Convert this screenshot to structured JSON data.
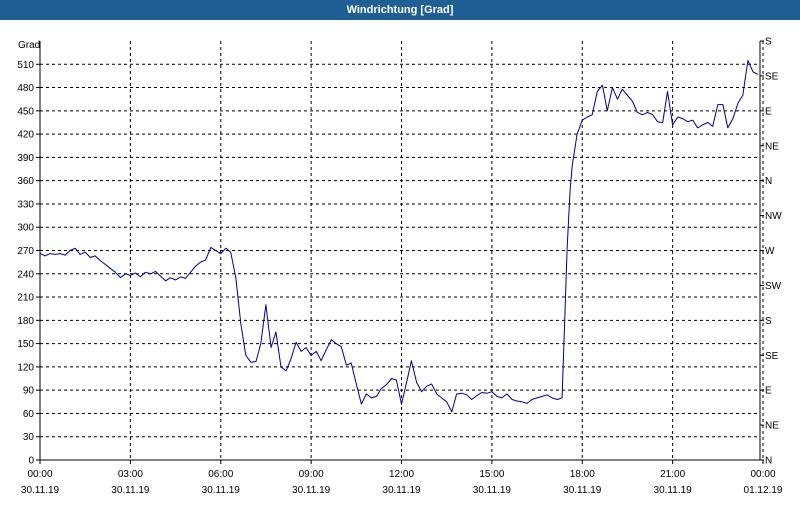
{
  "window": {
    "title": "Windrichtung [Grad]"
  },
  "chart_data": {
    "type": "line",
    "title": "Windrichtung [Grad]",
    "ylabel": "Grad",
    "xlabel": "",
    "ylim": [
      0,
      540
    ],
    "xlim_hours": [
      0,
      23.9
    ],
    "grid": true,
    "y_ticks": [
      0,
      30,
      60,
      90,
      120,
      150,
      180,
      210,
      240,
      270,
      300,
      330,
      360,
      390,
      420,
      450,
      480,
      510
    ],
    "x_ticks": [
      {
        "h": 0,
        "time": "00:00",
        "date": "30.11.19"
      },
      {
        "h": 3,
        "time": "03:00",
        "date": "30.11.19"
      },
      {
        "h": 6,
        "time": "06:00",
        "date": "30.11.19"
      },
      {
        "h": 9,
        "time": "09:00",
        "date": "30.11.19"
      },
      {
        "h": 12,
        "time": "12:00",
        "date": "30.11.19"
      },
      {
        "h": 15,
        "time": "15:00",
        "date": "30.11.19"
      },
      {
        "h": 18,
        "time": "18:00",
        "date": "30.11.19"
      },
      {
        "h": 21,
        "time": "21:00",
        "date": "30.11.19"
      },
      {
        "h": 24,
        "time": "00:00",
        "date": "01.12.19"
      }
    ],
    "right_axis": [
      {
        "value": 0,
        "label": "N"
      },
      {
        "value": 45,
        "label": "NE"
      },
      {
        "value": 90,
        "label": "E"
      },
      {
        "value": 135,
        "label": "SE"
      },
      {
        "value": 180,
        "label": "S"
      },
      {
        "value": 225,
        "label": "SW"
      },
      {
        "value": 270,
        "label": "W"
      },
      {
        "value": 315,
        "label": "NW"
      },
      {
        "value": 360,
        "label": "N"
      },
      {
        "value": 405,
        "label": "NE"
      },
      {
        "value": 450,
        "label": "E"
      },
      {
        "value": 495,
        "label": "SE"
      },
      {
        "value": 540,
        "label": "S"
      }
    ],
    "series": [
      {
        "color": "#00008b",
        "points": [
          [
            0.0,
            266
          ],
          [
            0.17,
            263
          ],
          [
            0.33,
            266
          ],
          [
            0.5,
            265
          ],
          [
            0.67,
            266
          ],
          [
            0.83,
            264
          ],
          [
            1.0,
            270
          ],
          [
            1.17,
            273
          ],
          [
            1.33,
            265
          ],
          [
            1.5,
            268
          ],
          [
            1.67,
            261
          ],
          [
            1.83,
            263
          ],
          [
            2.0,
            257
          ],
          [
            2.17,
            252
          ],
          [
            2.33,
            247
          ],
          [
            2.5,
            242
          ],
          [
            2.67,
            235
          ],
          [
            2.83,
            240
          ],
          [
            3.0,
            238
          ],
          [
            3.17,
            241
          ],
          [
            3.33,
            236
          ],
          [
            3.5,
            242
          ],
          [
            3.67,
            240
          ],
          [
            3.83,
            243
          ],
          [
            4.0,
            237
          ],
          [
            4.17,
            231
          ],
          [
            4.33,
            235
          ],
          [
            4.5,
            232
          ],
          [
            4.67,
            236
          ],
          [
            4.83,
            234
          ],
          [
            5.0,
            242
          ],
          [
            5.17,
            250
          ],
          [
            5.33,
            255
          ],
          [
            5.5,
            258
          ],
          [
            5.67,
            274
          ],
          [
            5.83,
            270
          ],
          [
            6.0,
            266
          ],
          [
            6.17,
            273
          ],
          [
            6.33,
            268
          ],
          [
            6.5,
            235
          ],
          [
            6.67,
            175
          ],
          [
            6.83,
            135
          ],
          [
            7.0,
            126
          ],
          [
            7.17,
            127
          ],
          [
            7.33,
            150
          ],
          [
            7.5,
            200
          ],
          [
            7.67,
            145
          ],
          [
            7.83,
            165
          ],
          [
            8.0,
            120
          ],
          [
            8.17,
            115
          ],
          [
            8.33,
            130
          ],
          [
            8.5,
            152
          ],
          [
            8.67,
            140
          ],
          [
            8.83,
            145
          ],
          [
            9.0,
            135
          ],
          [
            9.17,
            140
          ],
          [
            9.33,
            128
          ],
          [
            9.5,
            142
          ],
          [
            9.67,
            155
          ],
          [
            9.83,
            150
          ],
          [
            10.0,
            146
          ],
          [
            10.17,
            122
          ],
          [
            10.33,
            125
          ],
          [
            10.5,
            98
          ],
          [
            10.67,
            72
          ],
          [
            10.83,
            85
          ],
          [
            11.0,
            80
          ],
          [
            11.17,
            82
          ],
          [
            11.33,
            92
          ],
          [
            11.5,
            97
          ],
          [
            11.67,
            105
          ],
          [
            11.83,
            103
          ],
          [
            12.0,
            72
          ],
          [
            12.17,
            100
          ],
          [
            12.33,
            128
          ],
          [
            12.5,
            100
          ],
          [
            12.67,
            88
          ],
          [
            12.83,
            95
          ],
          [
            13.0,
            98
          ],
          [
            13.17,
            85
          ],
          [
            13.33,
            80
          ],
          [
            13.5,
            75
          ],
          [
            13.67,
            62
          ],
          [
            13.83,
            85
          ],
          [
            14.0,
            86
          ],
          [
            14.17,
            84
          ],
          [
            14.33,
            78
          ],
          [
            14.5,
            83
          ],
          [
            14.67,
            87
          ],
          [
            14.83,
            86
          ],
          [
            15.0,
            88
          ],
          [
            15.17,
            82
          ],
          [
            15.33,
            80
          ],
          [
            15.5,
            85
          ],
          [
            15.67,
            78
          ],
          [
            15.83,
            76
          ],
          [
            16.0,
            75
          ],
          [
            16.17,
            73
          ],
          [
            16.33,
            78
          ],
          [
            16.5,
            80
          ],
          [
            16.67,
            82
          ],
          [
            16.83,
            84
          ],
          [
            17.0,
            80
          ],
          [
            17.17,
            78
          ],
          [
            17.33,
            80
          ],
          [
            17.5,
            275
          ],
          [
            17.6,
            350
          ],
          [
            17.67,
            380
          ],
          [
            17.83,
            420
          ],
          [
            18.0,
            438
          ],
          [
            18.17,
            442
          ],
          [
            18.33,
            445
          ],
          [
            18.5,
            475
          ],
          [
            18.67,
            483
          ],
          [
            18.83,
            450
          ],
          [
            19.0,
            480
          ],
          [
            19.17,
            465
          ],
          [
            19.33,
            478
          ],
          [
            19.5,
            470
          ],
          [
            19.67,
            462
          ],
          [
            19.83,
            448
          ],
          [
            20.0,
            445
          ],
          [
            20.17,
            448
          ],
          [
            20.33,
            445
          ],
          [
            20.5,
            436
          ],
          [
            20.67,
            435
          ],
          [
            20.83,
            475
          ],
          [
            21.0,
            432
          ],
          [
            21.17,
            442
          ],
          [
            21.33,
            440
          ],
          [
            21.5,
            436
          ],
          [
            21.67,
            438
          ],
          [
            21.83,
            428
          ],
          [
            22.0,
            432
          ],
          [
            22.17,
            435
          ],
          [
            22.33,
            430
          ],
          [
            22.5,
            458
          ],
          [
            22.67,
            458
          ],
          [
            22.83,
            428
          ],
          [
            23.0,
            440
          ],
          [
            23.17,
            460
          ],
          [
            23.33,
            470
          ],
          [
            23.5,
            515
          ],
          [
            23.67,
            500
          ],
          [
            23.83,
            497
          ]
        ]
      }
    ]
  }
}
